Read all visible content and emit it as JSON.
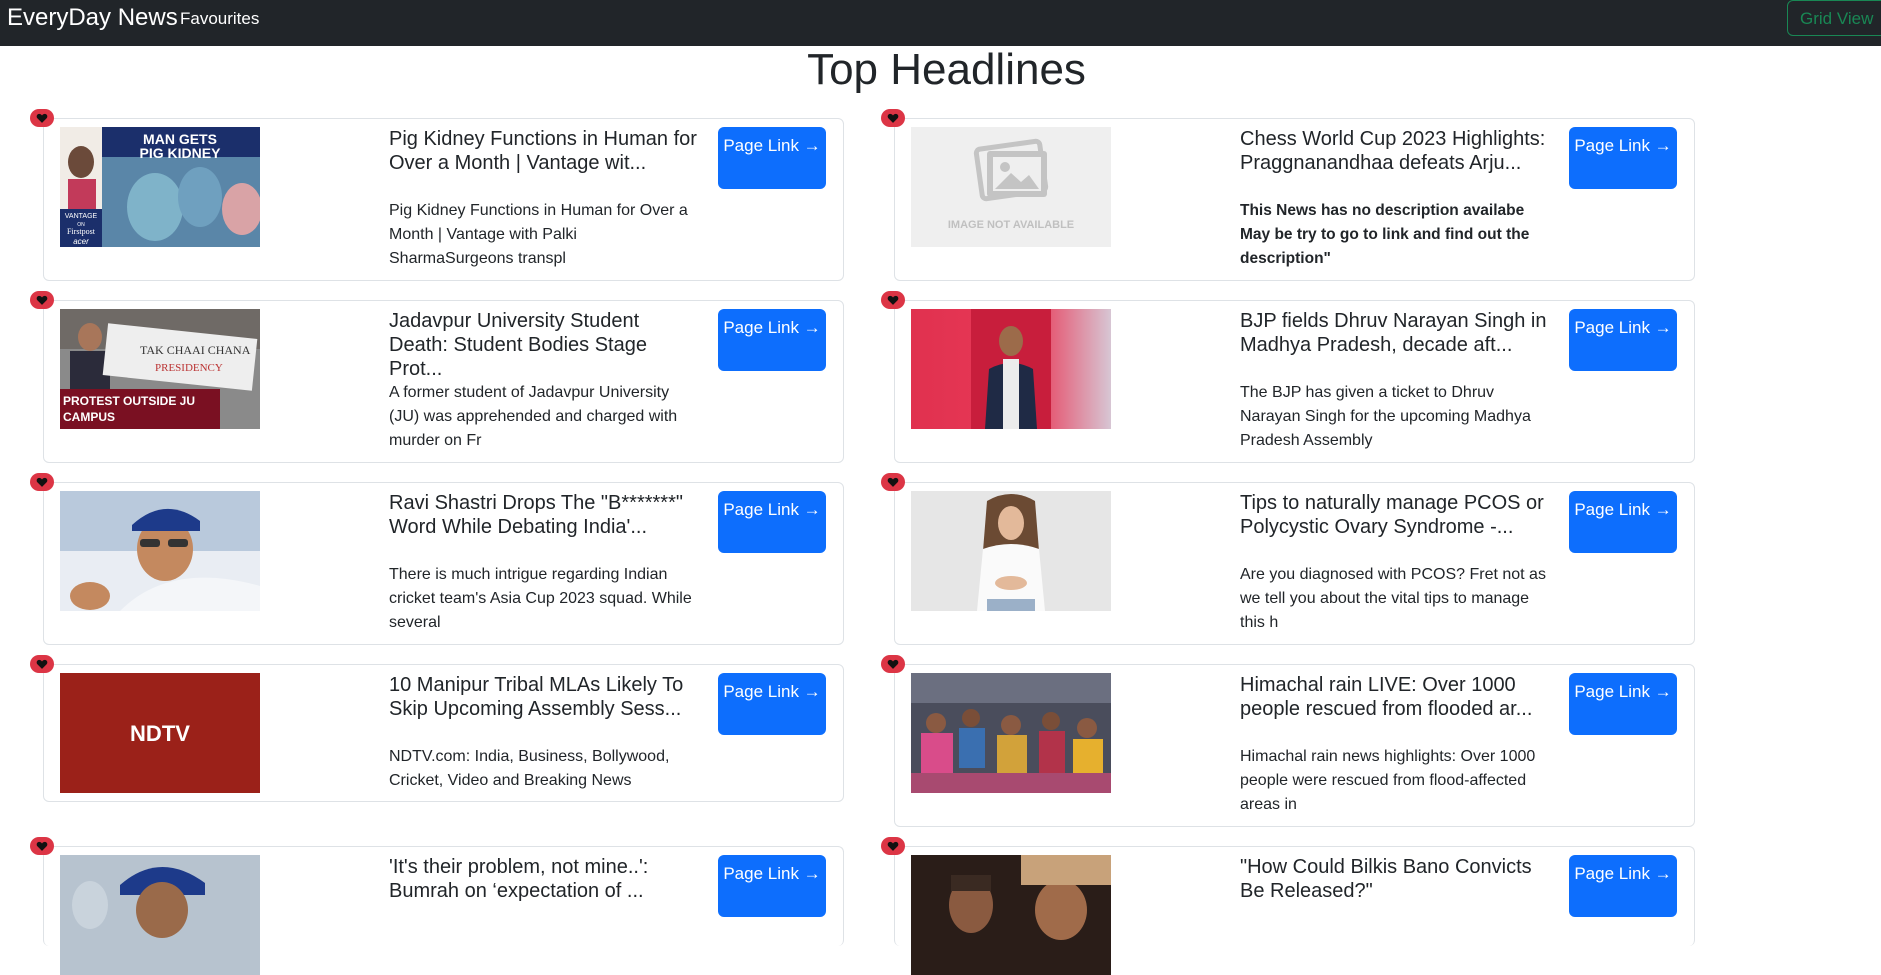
{
  "navbar": {
    "brand": "EveryDay News",
    "favourites": "Favourites",
    "grid_view": "Grid View"
  },
  "page": {
    "title": "Top Headlines"
  },
  "colors": {
    "navbar_bg": "#212529",
    "primary_button": "#0d6efd",
    "favourite_heart": "#dc3545",
    "grid_view_outline": "#198754"
  },
  "cards": [
    {
      "title": "Pig Kidney Functions in Human for Over a Month | Vantage wit...",
      "description": "Pig Kidney Functions in Human for Over a Month | Vantage with Palki SharmaSurgeons transpl",
      "button": "Page Link →",
      "image_overlay": [
        "MAN GETS",
        "PIG KIDNEY"
      ],
      "image_overlay_extra": [
        "VANTAGE",
        "ON",
        "Firstpost",
        "acer"
      ]
    },
    {
      "title": "Chess World Cup 2023 Highlights: Praggnanandhaa defeats Arju...",
      "description": "This News has no description availabe May be try to go to link and find out the description\"",
      "button": "Page Link →",
      "image_overlay": [
        "IMAGE NOT AVAILABLE"
      ]
    },
    {
      "title": "Jadavpur University Student Death: Student Bodies Stage Prot...",
      "description": "A former student of Jadavpur University (JU) was apprehended and charged with murder on Fr",
      "button": "Page Link →",
      "image_overlay": [
        "PROTEST OUTSIDE JU",
        "CAMPUS"
      ]
    },
    {
      "title": "BJP fields Dhruv Narayan Singh in Madhya Pradesh, decade aft...",
      "description": "The BJP has given a ticket to Dhruv Narayan Singh for the upcoming Madhya Pradesh Assembly",
      "button": "Page Link →"
    },
    {
      "title": "Ravi Shastri Drops The \"B*******\" Word While Debating India'...",
      "description": "There is much intrigue regarding Indian cricket team's Asia Cup 2023 squad. While several",
      "button": "Page Link →"
    },
    {
      "title": "Tips to naturally manage PCOS or Polycystic Ovary Syndrome -...",
      "description": "Are you diagnosed with PCOS? Fret not as we tell you about the vital tips to manage this h",
      "button": "Page Link →"
    },
    {
      "title": "10 Manipur Tribal MLAs Likely To Skip Upcoming Assembly Sess...",
      "description": "NDTV.com: India, Business, Bollywood, Cricket, Video and Breaking News",
      "button": "Page Link →",
      "image_overlay": [
        "NDTV"
      ]
    },
    {
      "title": "Himachal rain LIVE: Over 1000 people rescued from flooded ar...",
      "description": "Himachal rain news highlights: Over 1000 people were rescued from flood-affected areas in",
      "button": "Page Link →"
    },
    {
      "title": "'It's their problem, not mine..': Bumrah on ‘expectation of ...",
      "description": "",
      "button": "Page Link →"
    },
    {
      "title": "\"How Could Bilkis Bano Convicts Be Released?\"",
      "description": "",
      "button": "Page Link →"
    }
  ]
}
